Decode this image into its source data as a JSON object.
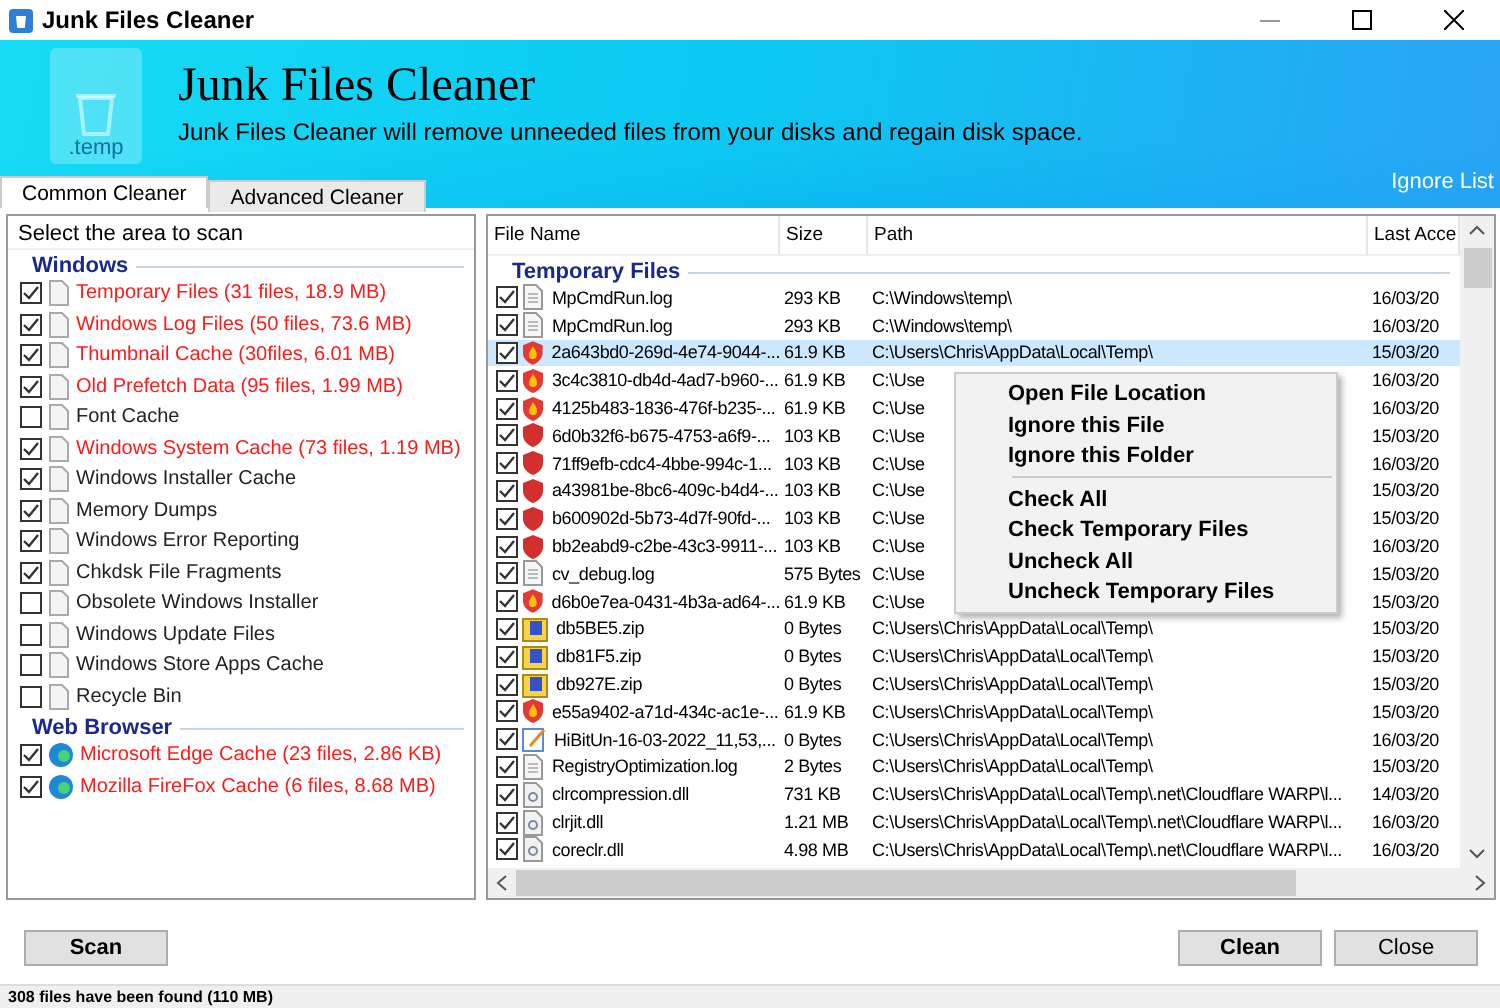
{
  "window": {
    "title": "Junk Files Cleaner"
  },
  "banner": {
    "title": "Junk Files Cleaner",
    "subtitle": "Junk Files Cleaner will remove unneeded files from your disks and regain disk space.",
    "icon_label": ".temp",
    "link": "Ignore List"
  },
  "tabs": [
    {
      "label": "Common Cleaner",
      "selected": true
    },
    {
      "label": "Advanced Cleaner",
      "selected": false
    }
  ],
  "scan_areas": {
    "header": "Select the area to scan",
    "sections": [
      {
        "title": "Windows",
        "kind": "system",
        "items": [
          {
            "label": "Temporary Files (31 files, 18.9 MB)",
            "checked": true,
            "found": true
          },
          {
            "label": "Windows Log Files (50 files, 73.6 MB)",
            "checked": true,
            "found": true
          },
          {
            "label": "Thumbnail Cache (30files, 6.01 MB)",
            "checked": true,
            "found": true
          },
          {
            "label": "Old Prefetch Data (95 files, 1.99 MB)",
            "checked": true,
            "found": true
          },
          {
            "label": "Font Cache",
            "checked": false,
            "found": false
          },
          {
            "label": "Windows System Cache (73 files, 1.19 MB)",
            "checked": true,
            "found": true
          },
          {
            "label": "Windows Installer Cache",
            "checked": true,
            "found": false
          },
          {
            "label": "Memory Dumps",
            "checked": true,
            "found": false
          },
          {
            "label": "Windows Error Reporting",
            "checked": true,
            "found": false
          },
          {
            "label": "Chkdsk File Fragments",
            "checked": true,
            "found": false
          },
          {
            "label": "Obsolete Windows Installer",
            "checked": false,
            "found": false
          },
          {
            "label": "Windows Update Files",
            "checked": false,
            "found": false
          },
          {
            "label": "Windows Store Apps Cache",
            "checked": false,
            "found": false
          },
          {
            "label": "Recycle Bin",
            "checked": false,
            "found": false
          }
        ]
      },
      {
        "title": "Web Browser",
        "kind": "browser",
        "items": [
          {
            "label": "Microsoft Edge Cache (23 files, 2.86 KB)",
            "checked": true,
            "found": true
          },
          {
            "label": "Mozilla FireFox Cache (6 files, 8.68 MB)",
            "checked": true,
            "found": true
          }
        ]
      }
    ]
  },
  "table": {
    "columns": [
      "File Name",
      "Size",
      "Path",
      "Last Acce"
    ],
    "group": "Temporary Files",
    "rows": [
      {
        "kind": "doc",
        "name": "MpCmdRun.log",
        "size": "293 KB",
        "path": "C:\\Windows\\temp\\",
        "date": "16/03/20",
        "checked": true,
        "selected": false
      },
      {
        "kind": "doc",
        "name": "MpCmdRun.log",
        "size": "293 KB",
        "path": "C:\\Windows\\temp\\",
        "date": "16/03/20",
        "checked": true,
        "selected": false
      },
      {
        "kind": "shield",
        "name": "2a643bd0-269d-4e74-9044-...",
        "size": "61.9 KB",
        "path": "C:\\Users\\Chris\\AppData\\Local\\Temp\\",
        "date": "15/03/20",
        "checked": true,
        "selected": true
      },
      {
        "kind": "shield",
        "name": "3c4c3810-db4d-4ad7-b960-...",
        "size": "61.9 KB",
        "path": "C:\\Use",
        "date": "16/03/20",
        "checked": true,
        "selected": false
      },
      {
        "kind": "shield",
        "name": "4125b483-1836-476f-b235-...",
        "size": "61.9 KB",
        "path": "C:\\Use",
        "date": "16/03/20",
        "checked": true,
        "selected": false
      },
      {
        "kind": "redshield",
        "name": "6d0b32f6-b675-4753-a6f9-...",
        "size": "103 KB",
        "path": "C:\\Use",
        "date": "15/03/20",
        "checked": true,
        "selected": false
      },
      {
        "kind": "redshield",
        "name": "71ff9efb-cdc4-4bbe-994c-1...",
        "size": "103 KB",
        "path": "C:\\Use",
        "date": "16/03/20",
        "checked": true,
        "selected": false
      },
      {
        "kind": "redshield",
        "name": "a43981be-8bc6-409c-b4d4-...",
        "size": "103 KB",
        "path": "C:\\Use",
        "date": "15/03/20",
        "checked": true,
        "selected": false
      },
      {
        "kind": "redshield",
        "name": "b600902d-5b73-4d7f-90fd-...",
        "size": "103 KB",
        "path": "C:\\Use",
        "date": "15/03/20",
        "checked": true,
        "selected": false
      },
      {
        "kind": "redshield",
        "name": "bb2eabd9-c2be-43c3-9911-...",
        "size": "103 KB",
        "path": "C:\\Use",
        "date": "16/03/20",
        "checked": true,
        "selected": false
      },
      {
        "kind": "doc",
        "name": "cv_debug.log",
        "size": "575 Bytes",
        "path": "C:\\Use",
        "date": "15/03/20",
        "checked": true,
        "selected": false
      },
      {
        "kind": "shield",
        "name": "d6b0e7ea-0431-4b3a-ad64-...",
        "size": "61.9 KB",
        "path": "C:\\Use",
        "date": "15/03/20",
        "checked": true,
        "selected": false
      },
      {
        "kind": "zip",
        "name": "db5BE5.zip",
        "size": "0 Bytes",
        "path": "C:\\Users\\Chris\\AppData\\Local\\Temp\\",
        "date": "15/03/20",
        "checked": true,
        "selected": false
      },
      {
        "kind": "zip",
        "name": "db81F5.zip",
        "size": "0 Bytes",
        "path": "C:\\Users\\Chris\\AppData\\Local\\Temp\\",
        "date": "15/03/20",
        "checked": true,
        "selected": false
      },
      {
        "kind": "zip",
        "name": "db927E.zip",
        "size": "0 Bytes",
        "path": "C:\\Users\\Chris\\AppData\\Local\\Temp\\",
        "date": "15/03/20",
        "checked": true,
        "selected": false
      },
      {
        "kind": "shield",
        "name": "e55a9402-a71d-434c-ac1e-...",
        "size": "61.9 KB",
        "path": "C:\\Users\\Chris\\AppData\\Local\\Temp\\",
        "date": "15/03/20",
        "checked": true,
        "selected": false
      },
      {
        "kind": "notepad",
        "name": "HiBitUn-16-03-2022_11,53,...",
        "size": "0 Bytes",
        "path": "C:\\Users\\Chris\\AppData\\Local\\Temp\\",
        "date": "16/03/20",
        "checked": true,
        "selected": false
      },
      {
        "kind": "doc",
        "name": "RegistryOptimization.log",
        "size": "2 Bytes",
        "path": "C:\\Users\\Chris\\AppData\\Local\\Temp\\",
        "date": "15/03/20",
        "checked": true,
        "selected": false
      },
      {
        "kind": "dll",
        "name": "clrcompression.dll",
        "size": "731 KB",
        "path": "C:\\Users\\Chris\\AppData\\Local\\Temp\\.net\\Cloudflare WARP\\l...",
        "date": "14/03/20",
        "checked": true,
        "selected": false
      },
      {
        "kind": "dll",
        "name": "clrjit.dll",
        "size": "1.21 MB",
        "path": "C:\\Users\\Chris\\AppData\\Local\\Temp\\.net\\Cloudflare WARP\\l...",
        "date": "16/03/20",
        "checked": true,
        "selected": false
      },
      {
        "kind": "dll",
        "name": "coreclr.dll",
        "size": "4.98 MB",
        "path": "C:\\Users\\Chris\\AppData\\Local\\Temp\\.net\\Cloudflare WARP\\l...",
        "date": "16/03/20",
        "checked": true,
        "selected": false
      }
    ]
  },
  "context_menu": [
    {
      "kind": "item",
      "label": "Open File Location"
    },
    {
      "kind": "item",
      "label": "Ignore this File"
    },
    {
      "kind": "item",
      "label": "Ignore this Folder"
    },
    {
      "kind": "separator"
    },
    {
      "kind": "item",
      "label": "Check All"
    },
    {
      "kind": "item",
      "label": "Check Temporary Files"
    },
    {
      "kind": "item",
      "label": "Uncheck All"
    },
    {
      "kind": "item",
      "label": "Uncheck Temporary Files"
    }
  ],
  "buttons": {
    "scan": "Scan",
    "clean": "Clean",
    "close": "Close"
  },
  "status_bar": "308  files have been found (110 MB)"
}
